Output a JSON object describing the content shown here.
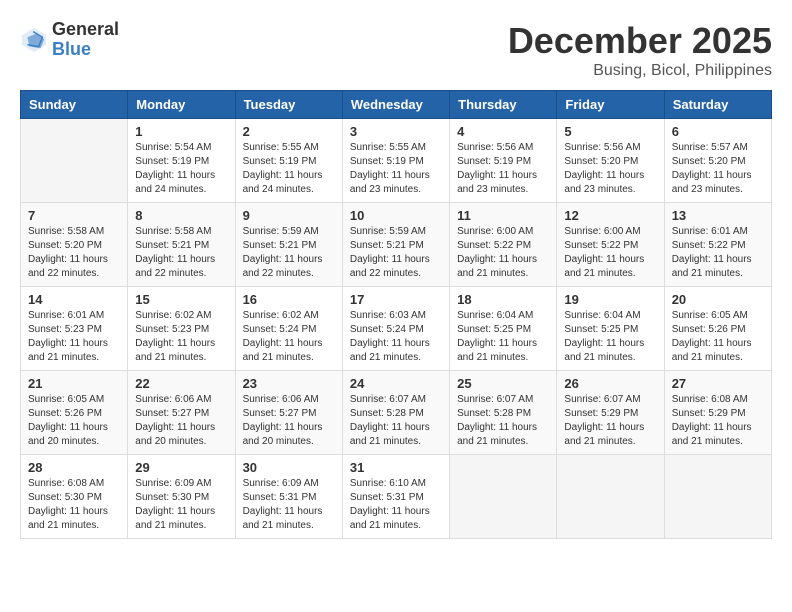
{
  "header": {
    "logo_general": "General",
    "logo_blue": "Blue",
    "month": "December 2025",
    "location": "Busing, Bicol, Philippines"
  },
  "weekdays": [
    "Sunday",
    "Monday",
    "Tuesday",
    "Wednesday",
    "Thursday",
    "Friday",
    "Saturday"
  ],
  "weeks": [
    [
      {
        "day": "",
        "info": ""
      },
      {
        "day": "1",
        "info": "Sunrise: 5:54 AM\nSunset: 5:19 PM\nDaylight: 11 hours\nand 24 minutes."
      },
      {
        "day": "2",
        "info": "Sunrise: 5:55 AM\nSunset: 5:19 PM\nDaylight: 11 hours\nand 24 minutes."
      },
      {
        "day": "3",
        "info": "Sunrise: 5:55 AM\nSunset: 5:19 PM\nDaylight: 11 hours\nand 23 minutes."
      },
      {
        "day": "4",
        "info": "Sunrise: 5:56 AM\nSunset: 5:19 PM\nDaylight: 11 hours\nand 23 minutes."
      },
      {
        "day": "5",
        "info": "Sunrise: 5:56 AM\nSunset: 5:20 PM\nDaylight: 11 hours\nand 23 minutes."
      },
      {
        "day": "6",
        "info": "Sunrise: 5:57 AM\nSunset: 5:20 PM\nDaylight: 11 hours\nand 23 minutes."
      }
    ],
    [
      {
        "day": "7",
        "info": "Sunrise: 5:58 AM\nSunset: 5:20 PM\nDaylight: 11 hours\nand 22 minutes."
      },
      {
        "day": "8",
        "info": "Sunrise: 5:58 AM\nSunset: 5:21 PM\nDaylight: 11 hours\nand 22 minutes."
      },
      {
        "day": "9",
        "info": "Sunrise: 5:59 AM\nSunset: 5:21 PM\nDaylight: 11 hours\nand 22 minutes."
      },
      {
        "day": "10",
        "info": "Sunrise: 5:59 AM\nSunset: 5:21 PM\nDaylight: 11 hours\nand 22 minutes."
      },
      {
        "day": "11",
        "info": "Sunrise: 6:00 AM\nSunset: 5:22 PM\nDaylight: 11 hours\nand 21 minutes."
      },
      {
        "day": "12",
        "info": "Sunrise: 6:00 AM\nSunset: 5:22 PM\nDaylight: 11 hours\nand 21 minutes."
      },
      {
        "day": "13",
        "info": "Sunrise: 6:01 AM\nSunset: 5:22 PM\nDaylight: 11 hours\nand 21 minutes."
      }
    ],
    [
      {
        "day": "14",
        "info": "Sunrise: 6:01 AM\nSunset: 5:23 PM\nDaylight: 11 hours\nand 21 minutes."
      },
      {
        "day": "15",
        "info": "Sunrise: 6:02 AM\nSunset: 5:23 PM\nDaylight: 11 hours\nand 21 minutes."
      },
      {
        "day": "16",
        "info": "Sunrise: 6:02 AM\nSunset: 5:24 PM\nDaylight: 11 hours\nand 21 minutes."
      },
      {
        "day": "17",
        "info": "Sunrise: 6:03 AM\nSunset: 5:24 PM\nDaylight: 11 hours\nand 21 minutes."
      },
      {
        "day": "18",
        "info": "Sunrise: 6:04 AM\nSunset: 5:25 PM\nDaylight: 11 hours\nand 21 minutes."
      },
      {
        "day": "19",
        "info": "Sunrise: 6:04 AM\nSunset: 5:25 PM\nDaylight: 11 hours\nand 21 minutes."
      },
      {
        "day": "20",
        "info": "Sunrise: 6:05 AM\nSunset: 5:26 PM\nDaylight: 11 hours\nand 21 minutes."
      }
    ],
    [
      {
        "day": "21",
        "info": "Sunrise: 6:05 AM\nSunset: 5:26 PM\nDaylight: 11 hours\nand 20 minutes."
      },
      {
        "day": "22",
        "info": "Sunrise: 6:06 AM\nSunset: 5:27 PM\nDaylight: 11 hours\nand 20 minutes."
      },
      {
        "day": "23",
        "info": "Sunrise: 6:06 AM\nSunset: 5:27 PM\nDaylight: 11 hours\nand 20 minutes."
      },
      {
        "day": "24",
        "info": "Sunrise: 6:07 AM\nSunset: 5:28 PM\nDaylight: 11 hours\nand 21 minutes."
      },
      {
        "day": "25",
        "info": "Sunrise: 6:07 AM\nSunset: 5:28 PM\nDaylight: 11 hours\nand 21 minutes."
      },
      {
        "day": "26",
        "info": "Sunrise: 6:07 AM\nSunset: 5:29 PM\nDaylight: 11 hours\nand 21 minutes."
      },
      {
        "day": "27",
        "info": "Sunrise: 6:08 AM\nSunset: 5:29 PM\nDaylight: 11 hours\nand 21 minutes."
      }
    ],
    [
      {
        "day": "28",
        "info": "Sunrise: 6:08 AM\nSunset: 5:30 PM\nDaylight: 11 hours\nand 21 minutes."
      },
      {
        "day": "29",
        "info": "Sunrise: 6:09 AM\nSunset: 5:30 PM\nDaylight: 11 hours\nand 21 minutes."
      },
      {
        "day": "30",
        "info": "Sunrise: 6:09 AM\nSunset: 5:31 PM\nDaylight: 11 hours\nand 21 minutes."
      },
      {
        "day": "31",
        "info": "Sunrise: 6:10 AM\nSunset: 5:31 PM\nDaylight: 11 hours\nand 21 minutes."
      },
      {
        "day": "",
        "info": ""
      },
      {
        "day": "",
        "info": ""
      },
      {
        "day": "",
        "info": ""
      }
    ]
  ]
}
